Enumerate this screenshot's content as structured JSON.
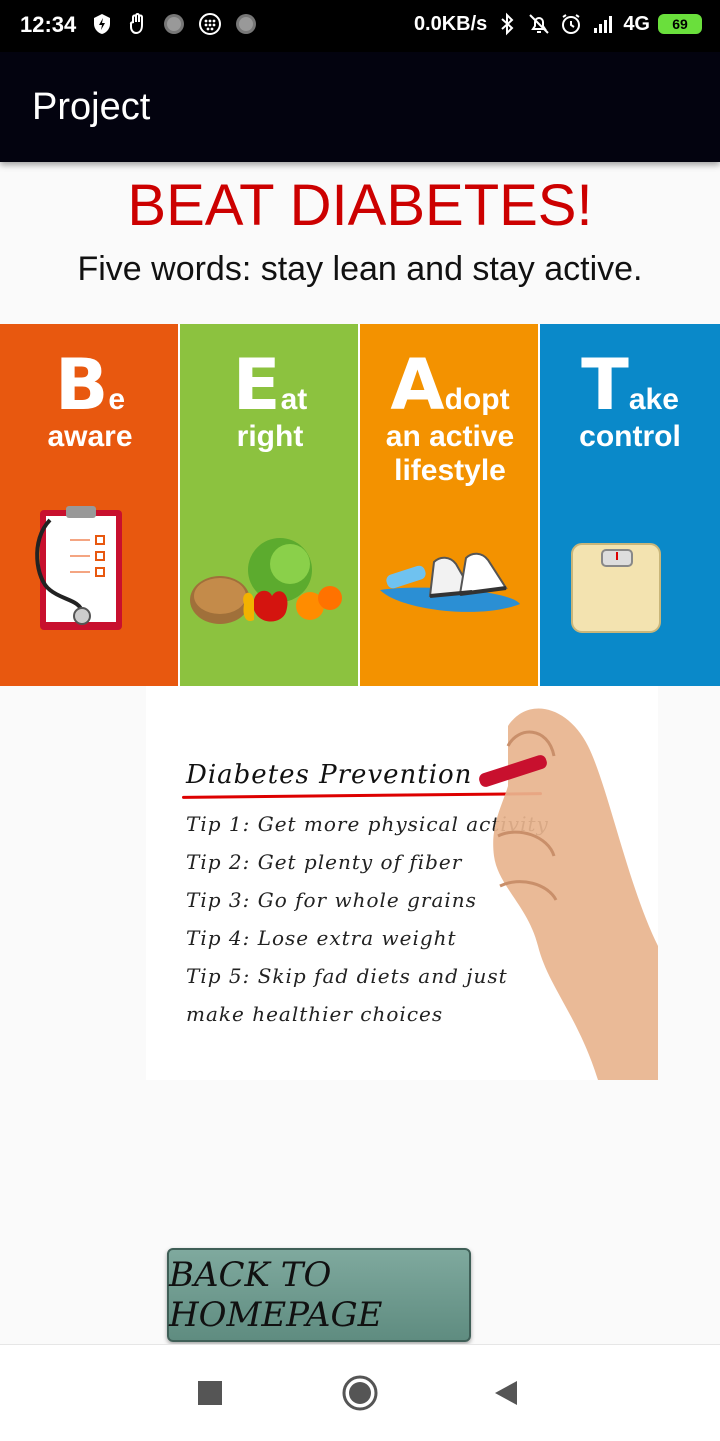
{
  "status_bar": {
    "time": "12:34",
    "speed": "0.0KB/s",
    "network": "4G",
    "battery": "69",
    "icons": [
      "flash-shield-icon",
      "hand-icon",
      "circle-dot-icon",
      "grid-dot-icon",
      "circle-dot-icon",
      "bluetooth-icon",
      "bell-off-icon",
      "alarm-icon",
      "signal-icon"
    ]
  },
  "app_bar": {
    "title": "Project"
  },
  "main": {
    "headline": "BEAT DIABETES!",
    "subline": "Five words: stay lean and stay active.",
    "banner": [
      {
        "letter": "B",
        "rest": "e",
        "line2": "aware",
        "color": "#e8580f"
      },
      {
        "letter": "E",
        "rest": "at",
        "line2": "right",
        "color": "#8cc23f"
      },
      {
        "letter": "A",
        "rest": "dopt",
        "line2": "an active",
        "line3": "lifestyle",
        "color": "#f39200"
      },
      {
        "letter": "T",
        "rest": "ake",
        "line2": "control",
        "color": "#0a89c9"
      }
    ],
    "prevention": {
      "title": "Diabetes Prevention",
      "tips": [
        "Tip 1: Get more physical activity",
        "Tip 2: Get plenty of fiber",
        "Tip 3: Go for whole grains",
        "Tip 4: Lose extra weight",
        "Tip 5: Skip fad diets and just",
        "make healthier choices"
      ]
    },
    "back_button": "BACK TO HOMEPAGE"
  },
  "colors": {
    "headline": "#cc0000",
    "app_bar": "#03030f",
    "button": "#6f998f"
  }
}
